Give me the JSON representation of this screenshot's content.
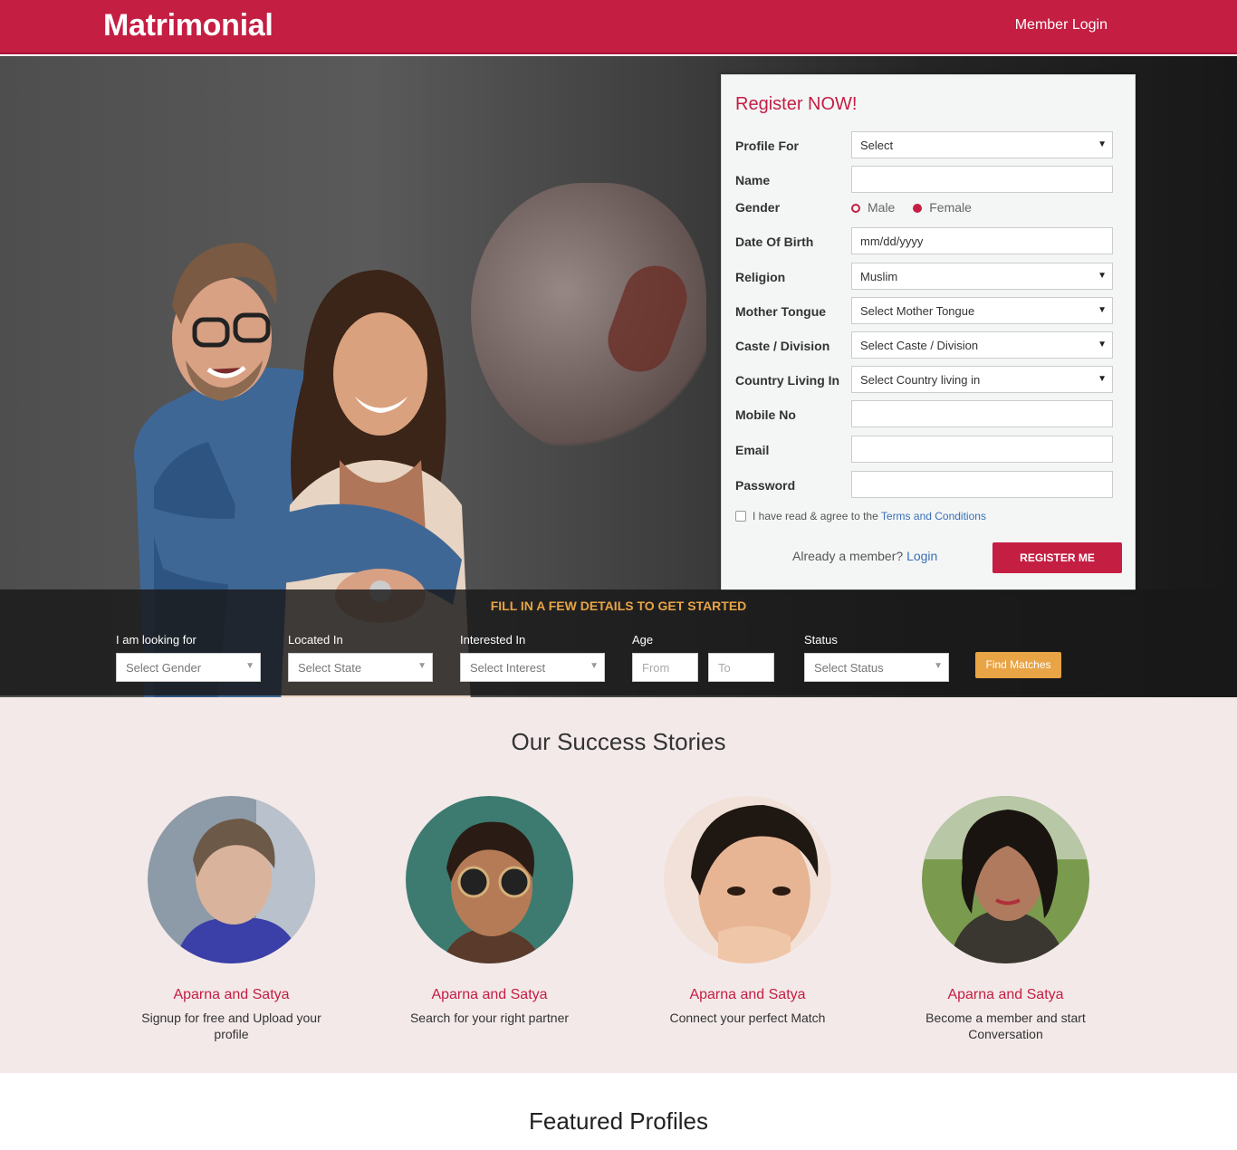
{
  "header": {
    "brand": "Matrimonial",
    "login": "Member Login"
  },
  "register": {
    "title": "Register NOW!",
    "fields": [
      {
        "label": "Profile For",
        "value": "Select",
        "type": "select"
      },
      {
        "label": "Name",
        "value": "",
        "type": "text"
      },
      {
        "label": "Gender",
        "type": "radio",
        "options": [
          "Male",
          "Female"
        ],
        "selected": "Female"
      },
      {
        "label": "Date Of Birth",
        "value": "mm/dd/yyyy",
        "type": "date"
      },
      {
        "label": "Religion",
        "value": "Muslim",
        "type": "select"
      },
      {
        "label": "Mother Tongue",
        "value": "Select Mother Tongue",
        "type": "select"
      },
      {
        "label": "Caste / Division",
        "value": "Select Caste / Division",
        "type": "select"
      },
      {
        "label": "Country Living In",
        "value": "Select Country living in",
        "type": "select"
      },
      {
        "label": "Mobile No",
        "value": "",
        "type": "text"
      },
      {
        "label": "Email",
        "value": "",
        "type": "text"
      },
      {
        "label": "Password",
        "value": "",
        "type": "text"
      }
    ],
    "terms_text": "I have read & agree to the",
    "terms_link": "Terms and Conditions",
    "already_text": "Already a member?",
    "already_link": "Login",
    "button": "REGISTER ME"
  },
  "search": {
    "title": "FILL IN A FEW DETAILS TO GET STARTED",
    "looking_for": {
      "label": "I am looking for",
      "value": "Select Gender"
    },
    "located_in": {
      "label": "Located In",
      "value": "Select State"
    },
    "interested_in": {
      "label": "Interested In",
      "value": "Select Interest"
    },
    "age": {
      "label": "Age",
      "from": "From",
      "to": "To"
    },
    "status": {
      "label": "Status",
      "value": "Select Status"
    },
    "button": "Find Matches"
  },
  "stories": {
    "title": "Our Success Stories",
    "items": [
      {
        "name": "Aparna and Satya",
        "text": "Signup for free and Upload your profile"
      },
      {
        "name": "Aparna and Satya",
        "text": "Search for your right partner"
      },
      {
        "name": "Aparna and Satya",
        "text": "Connect your perfect Match"
      },
      {
        "name": "Aparna and Satya",
        "text": "Become a member and start Conversation"
      }
    ]
  },
  "featured": {
    "title": "Featured Profiles"
  },
  "colors": {
    "brand": "#c41e42",
    "accent": "#e8a445",
    "stories_bg": "#f3e9e9",
    "link": "#3a6fb5"
  },
  "icons": {
    "select_caret": "caret-down-icon"
  }
}
